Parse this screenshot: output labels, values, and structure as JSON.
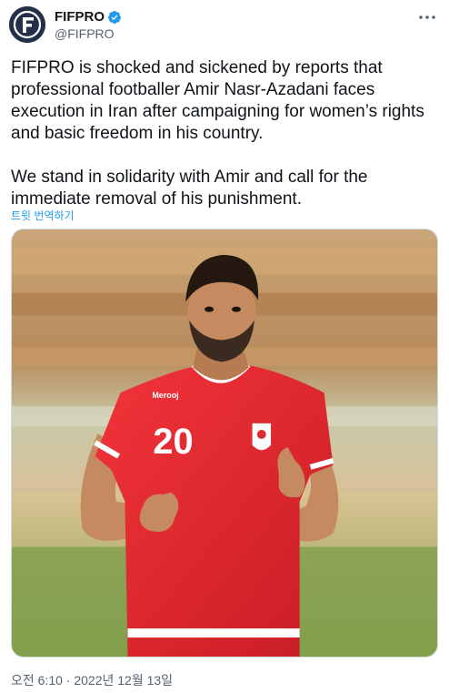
{
  "author": {
    "display_name": "FIFPRO",
    "handle": "@FIFPRO",
    "verified": true,
    "avatar_icon": "fifpro-logo-icon"
  },
  "tweet": {
    "text": "FIFPRO is shocked and sickened by reports that professional footballer Amir Nasr-Azadani faces execution in Iran after campaigning for women’s rights and basic freedom in his country.\n\nWe stand in solidarity with Amir and call for the immediate removal of his punishment.",
    "translate_label": "트윗 번역하기",
    "timestamp": "오전 6:10 · 2022년 12월 13일"
  },
  "media": {
    "jersey_number": "20",
    "description_icon": "photo"
  },
  "colors": {
    "link": "#1d9bf0",
    "secondary_text": "#536471",
    "verified": "#1d9bf0"
  }
}
